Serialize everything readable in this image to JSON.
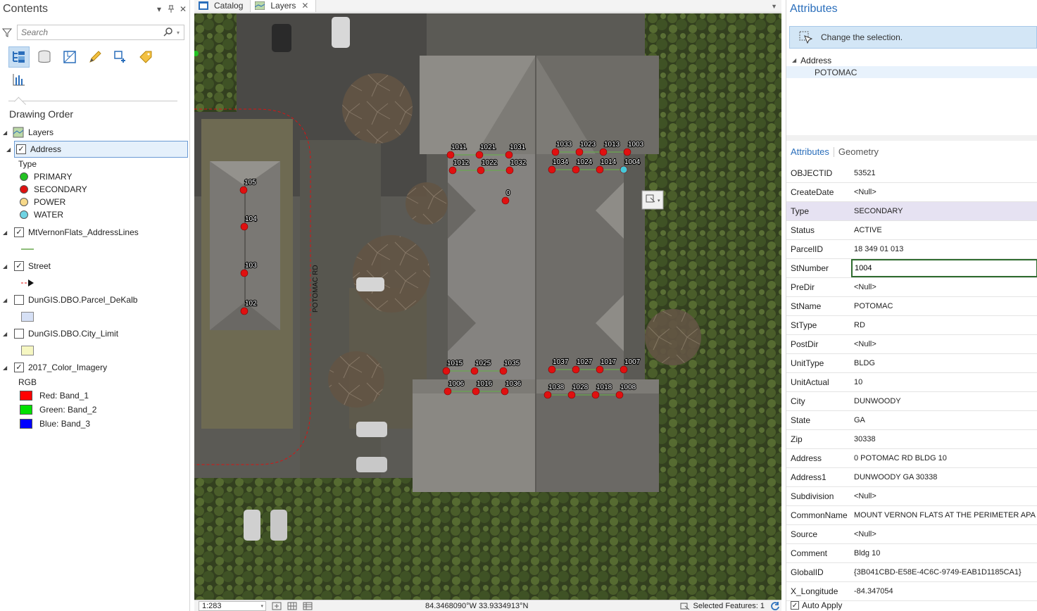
{
  "contents": {
    "title": "Contents",
    "search_placeholder": "Search",
    "drawing_order": "Drawing Order",
    "layers_root": "Layers",
    "layers": [
      {
        "name": "Address",
        "checked": true
      },
      {
        "name": "MtVernonFlats_AddressLines",
        "checked": true
      },
      {
        "name": "Street",
        "checked": true
      },
      {
        "name": "DunGIS.DBO.Parcel_DeKalb",
        "checked": false
      },
      {
        "name": "DunGIS.DBO.City_Limit",
        "checked": false
      },
      {
        "name": "2017_Color_Imagery",
        "checked": true
      }
    ],
    "address_legend": {
      "heading": "Type",
      "items": [
        {
          "label": "PRIMARY",
          "color": "#22c322"
        },
        {
          "label": "SECONDARY",
          "color": "#e01010"
        },
        {
          "label": "POWER",
          "color": "#f7d98a"
        },
        {
          "label": "WATER",
          "color": "#6fd3e3"
        }
      ]
    },
    "imagery_legend": {
      "heading": "RGB",
      "items": [
        {
          "label": "Red:",
          "band": "Band_1",
          "color": "#ff0000"
        },
        {
          "label": "Green:",
          "band": "Band_2",
          "color": "#00e000"
        },
        {
          "label": "Blue:",
          "band": "Band_3",
          "color": "#0000ff"
        }
      ]
    },
    "colors": {
      "parcel_fill": "#d6e0f5",
      "city_fill": "#f6f7c2",
      "line_green": "#6aa84f"
    }
  },
  "tabs": [
    {
      "label": "Catalog",
      "active": false
    },
    {
      "label": "Layers",
      "active": true
    }
  ],
  "map": {
    "street_label": "POTOMAC RD",
    "point_colors": {
      "secondary": "#e01010",
      "water": "#45c8d8"
    },
    "points": [
      {
        "label": "1011"
      },
      {
        "label": "1021"
      },
      {
        "label": "1031"
      },
      {
        "label": "1012"
      },
      {
        "label": "1022"
      },
      {
        "label": "1032"
      },
      {
        "label": "1033"
      },
      {
        "label": "1023"
      },
      {
        "label": "1013"
      },
      {
        "label": "1003"
      },
      {
        "label": "1034"
      },
      {
        "label": "1024"
      },
      {
        "label": "1014"
      },
      {
        "label": "1004"
      },
      {
        "label": "0"
      },
      {
        "label": "105"
      },
      {
        "label": "104"
      },
      {
        "label": "103"
      },
      {
        "label": "102"
      },
      {
        "label": "1015"
      },
      {
        "label": "1025"
      },
      {
        "label": "1035"
      },
      {
        "label": "1006"
      },
      {
        "label": "1016"
      },
      {
        "label": "1036"
      },
      {
        "label": "1037"
      },
      {
        "label": "1027"
      },
      {
        "label": "1017"
      },
      {
        "label": "1007"
      },
      {
        "label": "1038"
      },
      {
        "label": "1028"
      },
      {
        "label": "1018"
      },
      {
        "label": "1008"
      }
    ]
  },
  "status": {
    "scale": "1:283",
    "coords": "84.3468090°W 33.9334913°N",
    "selected": "Selected Features: 1"
  },
  "attributes": {
    "title": "Attributes",
    "info": "Change the selection.",
    "tree_parent": "Address",
    "tree_child": "POTOMAC",
    "tab_attributes": "Attributes",
    "tab_geometry": "Geometry",
    "rows": [
      {
        "k": "OBJECTID",
        "v": "53521"
      },
      {
        "k": "CreateDate",
        "v": "<Null>"
      },
      {
        "k": "Type",
        "v": "SECONDARY"
      },
      {
        "k": "Status",
        "v": "ACTIVE"
      },
      {
        "k": "ParcelID",
        "v": "18 349 01 013"
      },
      {
        "k": "StNumber",
        "v": "1004"
      },
      {
        "k": "PreDir",
        "v": "<Null>"
      },
      {
        "k": "StName",
        "v": "POTOMAC"
      },
      {
        "k": "StType",
        "v": "RD"
      },
      {
        "k": "PostDir",
        "v": "<Null>"
      },
      {
        "k": "UnitType",
        "v": "BLDG"
      },
      {
        "k": "UnitActual",
        "v": "10"
      },
      {
        "k": "City",
        "v": "DUNWOODY"
      },
      {
        "k": "State",
        "v": "GA"
      },
      {
        "k": "Zip",
        "v": "30338"
      },
      {
        "k": "Address",
        "v": "0 POTOMAC RD BLDG 10"
      },
      {
        "k": "Address1",
        "v": "DUNWOODY GA 30338"
      },
      {
        "k": "Subdivision",
        "v": "<Null>"
      },
      {
        "k": "CommonName",
        "v": "MOUNT VERNON FLATS AT THE PERIMETER APA"
      },
      {
        "k": "Source",
        "v": "<Null>"
      },
      {
        "k": "Comment",
        "v": "Bldg 10"
      },
      {
        "k": "GlobalID",
        "v": "{3B041CBD-E58E-4C6C-9749-EAB1D1185CA1}"
      },
      {
        "k": "X_Longitude",
        "v": "-84.347054"
      }
    ],
    "auto_apply": "Auto Apply"
  }
}
